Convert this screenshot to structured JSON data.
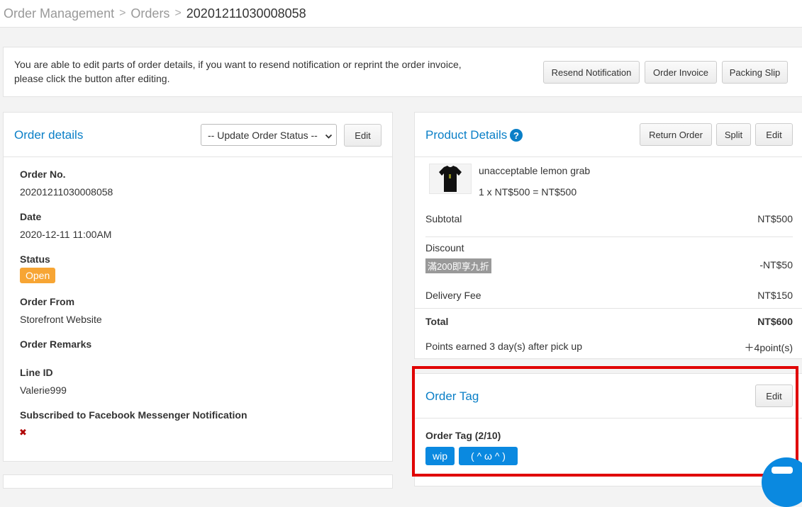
{
  "breadcrumb": {
    "items": [
      "Order Management",
      "Orders"
    ],
    "current": "20201211030008058",
    "separator": ">"
  },
  "notice": {
    "line1": "You are able to edit parts of order details, if you want to resend notification or reprint the order invoice,",
    "line2": "please click the button after editing.",
    "buttons": {
      "resend": "Resend Notification",
      "invoice": "Order Invoice",
      "packing": "Packing Slip"
    }
  },
  "order_details": {
    "title": "Order details",
    "status_select": "-- Update Order Status --",
    "edit": "Edit",
    "fields": {
      "order_no_label": "Order No.",
      "order_no": "20201211030008058",
      "date_label": "Date",
      "date": "2020-12-11 11:00AM",
      "status_label": "Status",
      "status": "Open",
      "from_label": "Order From",
      "from": "Storefront Website",
      "remarks_label": "Order Remarks",
      "line_label": "Line ID",
      "line": "Valerie999",
      "messenger_label": "Subscribed to Facebook Messenger Notification",
      "messenger_mark": "✖"
    }
  },
  "product_details": {
    "title": "Product Details",
    "help": "?",
    "buttons": {
      "return": "Return Order",
      "split": "Split",
      "edit": "Edit"
    },
    "item": {
      "name": "unacceptable lemon grab",
      "qty_price": "1 x NT$500 = NT$500"
    },
    "subtotal_label": "Subtotal",
    "subtotal": "NT$500",
    "discount_label": "Discount",
    "discount_name": "滿200即享九折",
    "discount": "-NT$50",
    "delivery_label": "Delivery Fee",
    "delivery": "NT$150",
    "total_label": "Total",
    "total": "NT$600",
    "points_label": "Points earned 3 day(s) after pick up",
    "points": "＋4point(s)"
  },
  "order_tag": {
    "title": "Order Tag",
    "edit": "Edit",
    "count_label": "Order Tag (2/10)",
    "tags": [
      "wip",
      "( ^ ω ^ )"
    ]
  },
  "colors": {
    "accent": "#0a7fc7",
    "tag": "#0a89e0",
    "status_open": "#f7a534",
    "highlight": "#e00000"
  }
}
